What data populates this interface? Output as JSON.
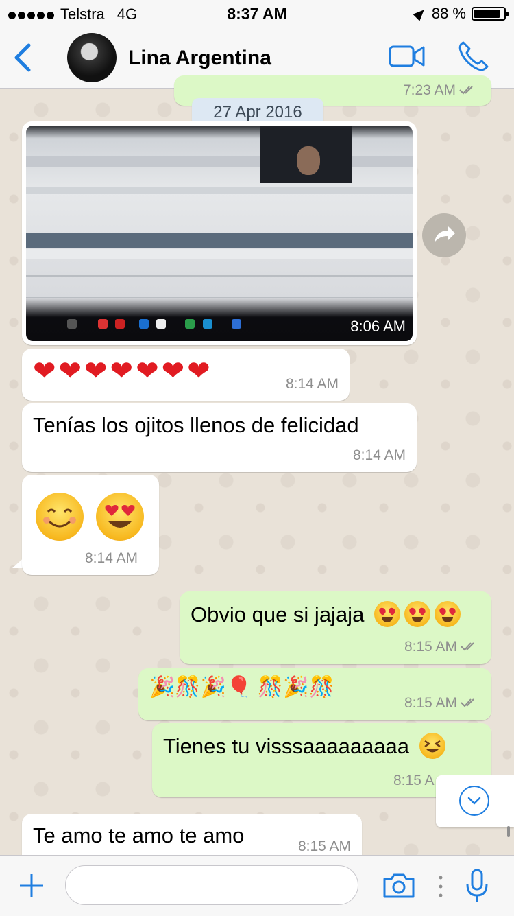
{
  "status_bar": {
    "carrier": "Telstra",
    "network": "4G",
    "time": "8:37 AM",
    "battery_percent": "88 %",
    "battery_level": 0.88
  },
  "header": {
    "contact_name": "Lina Argentina",
    "icons": [
      "back-icon",
      "video-call-icon",
      "phone-icon"
    ]
  },
  "messages": {
    "partial_top_time": "7:23 AM",
    "date_chip": "27 Apr 2016",
    "photo_time": "8:06 AM",
    "hearts_text": "❤❤❤❤❤❤❤",
    "hearts_time": "8:14 AM",
    "felicidad_text": "Tenías los ojitos llenos de felicidad",
    "felicidad_time": "8:14 AM",
    "emoji_time": "8:14 AM",
    "obvio_text": "Obvio que si jajaja",
    "obvio_time": "8:15 AM",
    "party_text": "🎉🎊🎉🎈 🎊🎉🎊",
    "party_time": "8:15 AM",
    "visa_text": "Tienes tu visssaaaaaaaaa",
    "visa_time": "8:15 A",
    "teamo_text": "Te amo te amo te amo",
    "teamo_time": "8:15 AM"
  },
  "composer": {
    "placeholder": ""
  },
  "colors": {
    "accent": "#1f7ee0",
    "outgoing_bubble": "#dcf8c6",
    "incoming_bubble": "#ffffff",
    "chat_background": "#e9e2d8"
  }
}
